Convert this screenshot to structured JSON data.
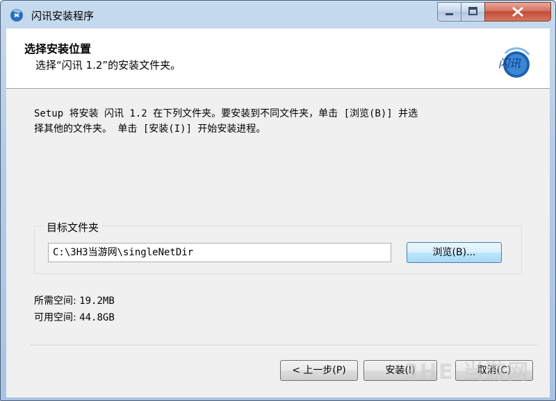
{
  "window": {
    "title": "闪讯安装程序",
    "icon": "app-icon"
  },
  "header": {
    "title": "选择安装位置",
    "subtitle": "选择“闪讯 1.2”的安装文件夹。",
    "logo_text": "闪讯"
  },
  "description": {
    "line1": "Setup 将安装 闪讯 1.2 在下列文件夹。要安装到不同文件夹，单击 [浏览(B)] 并选",
    "line2": "择其他的文件夹。 单击 [安装(I)] 开始安装进程。"
  },
  "destination": {
    "group_label": "目标文件夹",
    "path": "C:\\3H3当游网\\singleNetDir",
    "browse_label": "浏览(B)..."
  },
  "space": {
    "required_label": "所需空间:",
    "required_value": "19.2MB",
    "available_label": "可用空间:",
    "available_value": "44.8GB"
  },
  "footer": {
    "back_label": "< 上一步(P)",
    "install_label": "安装(I)",
    "cancel_label": "取消(C)",
    "watermark": "3HE 当游网"
  }
}
